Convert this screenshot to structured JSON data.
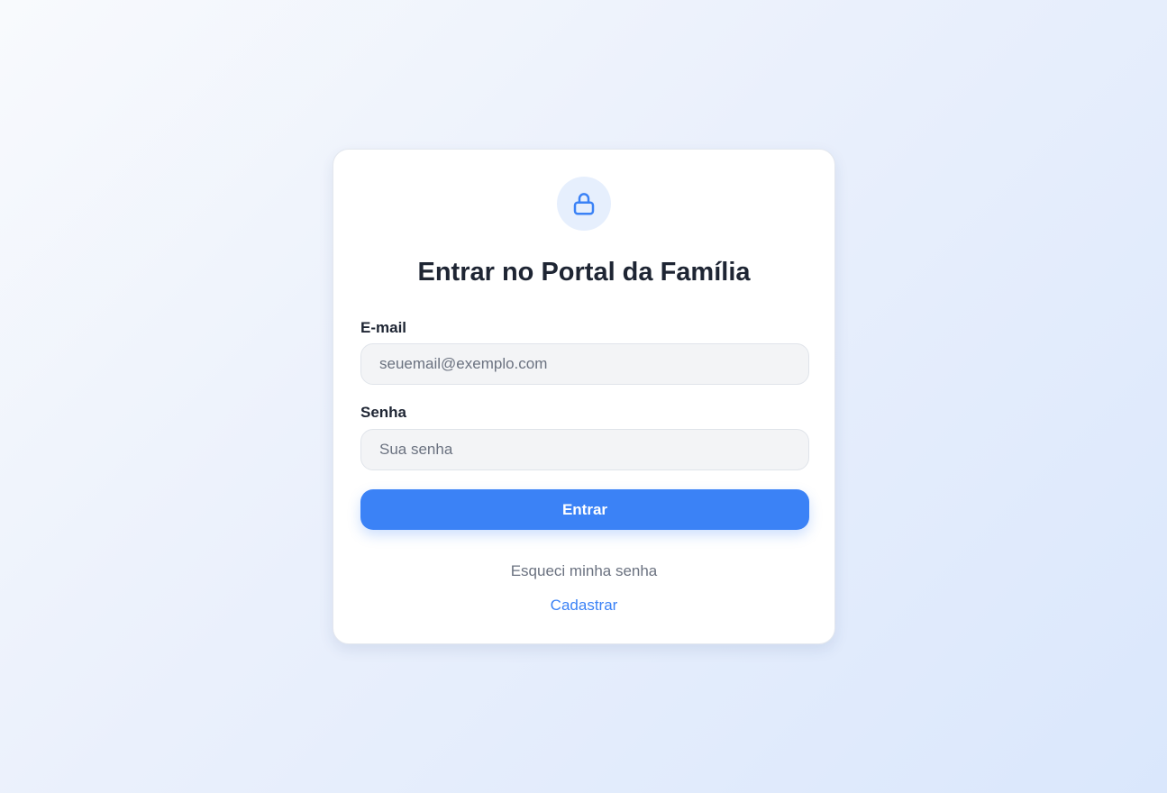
{
  "login": {
    "title": "Entrar no Portal da Família",
    "icon": "lock-icon",
    "email": {
      "label": "E-mail",
      "value": "",
      "placeholder": "seuemail@exemplo.com"
    },
    "password": {
      "label": "Senha",
      "value": "",
      "placeholder": "Sua senha"
    },
    "submit_label": "Entrar",
    "forgot_label": "Esqueci minha senha",
    "signup_label": "Cadastrar"
  },
  "colors": {
    "accent": "#3b82f6",
    "icon_bg": "#e6effd",
    "title_text": "#1e2533",
    "muted_text": "#6b7280",
    "input_bg": "#f3f4f6"
  }
}
